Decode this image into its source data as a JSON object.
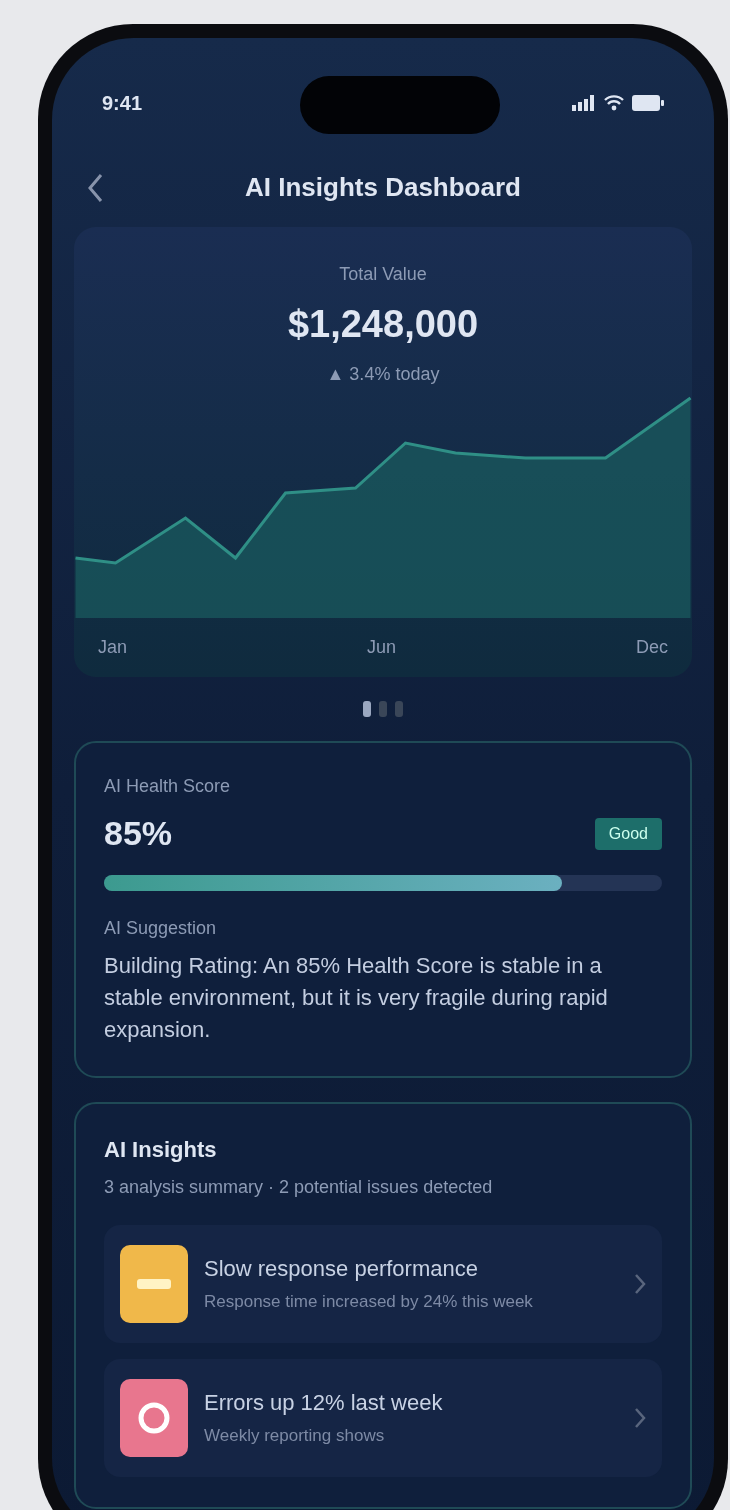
{
  "status_bar": {
    "time": "9:41"
  },
  "header": {
    "title": "AI Insights Dashboard"
  },
  "summary": {
    "label": "Total Value",
    "amount": "$1,248,000",
    "change": "▲ 3.4% today",
    "x_labels": [
      "Jan",
      "Jun",
      "Dec"
    ]
  },
  "pager": [
    {
      "selected": true
    },
    {
      "selected": false
    },
    {
      "selected": false
    }
  ],
  "health": {
    "title": "AI Health Score",
    "score": "85%",
    "badge": "Good",
    "level": 0.82,
    "suggestion_title": "AI Suggestion",
    "suggestion": "Building Rating: An 85% Health Score is stable in a stable environment, but it is very fragile during rapid expansion."
  },
  "insights": {
    "title": "AI Insights",
    "summary": "3 analysis summary · 2 potential issues detected",
    "items": [
      {
        "kind": "warning",
        "color": "#f0b84a",
        "title": "Slow response performance",
        "detail": "Response time increased by 24% this week"
      },
      {
        "kind": "alert",
        "color": "#e8768e",
        "title": "Errors up 12% last week",
        "detail": "Weekly reporting shows"
      }
    ]
  }
}
